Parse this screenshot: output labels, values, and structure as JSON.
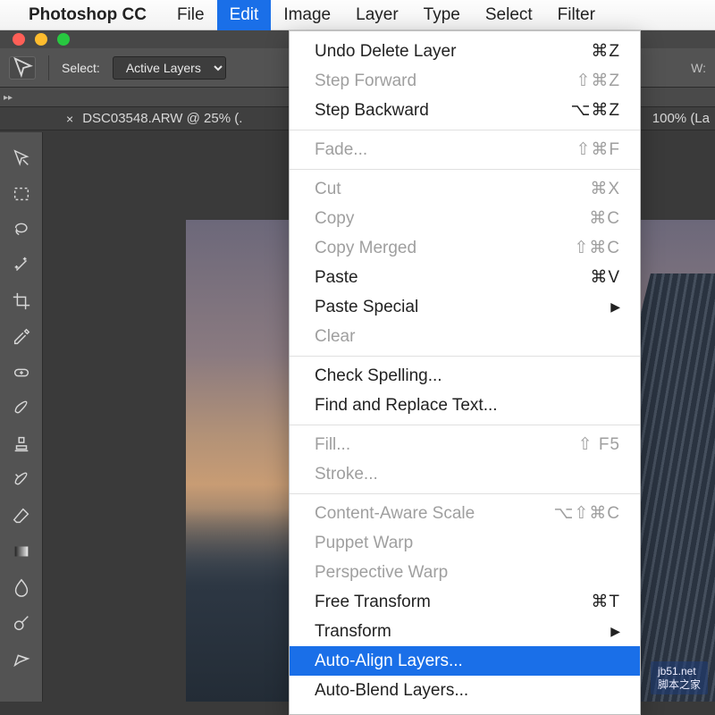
{
  "menubar": {
    "app": "Photoshop CC",
    "items": [
      "File",
      "Edit",
      "Image",
      "Layer",
      "Type",
      "Select",
      "Filter"
    ],
    "active_index": 1
  },
  "optionsbar": {
    "select_label": "Select:",
    "select_value": "Active Layers",
    "w_label": "W:"
  },
  "tab": {
    "filename": "DSC03548.ARW @ 25% (.",
    "zoom_suffix": "100% (La"
  },
  "tools": [
    "move-tool",
    "marquee-tool",
    "lasso-tool",
    "magic-wand-tool",
    "crop-tool",
    "eyedropper-tool",
    "healing-brush-tool",
    "brush-tool",
    "stamp-tool",
    "history-brush-tool",
    "eraser-tool",
    "gradient-tool",
    "blur-tool",
    "dodge-tool",
    "pen-tool"
  ],
  "edit_menu": [
    {
      "label": "Undo Delete Layer",
      "sc": "⌘Z"
    },
    {
      "label": "Step Forward",
      "sc": "⇧⌘Z",
      "disabled": true
    },
    {
      "label": "Step Backward",
      "sc": "⌥⌘Z"
    },
    {
      "sep": true
    },
    {
      "label": "Fade...",
      "sc": "⇧⌘F",
      "disabled": true
    },
    {
      "sep": true
    },
    {
      "label": "Cut",
      "sc": "⌘X",
      "disabled": true
    },
    {
      "label": "Copy",
      "sc": "⌘C",
      "disabled": true
    },
    {
      "label": "Copy Merged",
      "sc": "⇧⌘C",
      "disabled": true
    },
    {
      "label": "Paste",
      "sc": "⌘V"
    },
    {
      "label": "Paste Special",
      "submenu": true
    },
    {
      "label": "Clear",
      "disabled": true
    },
    {
      "sep": true
    },
    {
      "label": "Check Spelling..."
    },
    {
      "label": "Find and Replace Text..."
    },
    {
      "sep": true
    },
    {
      "label": "Fill...",
      "sc": "⇧ F5",
      "disabled": true
    },
    {
      "label": "Stroke...",
      "disabled": true
    },
    {
      "sep": true
    },
    {
      "label": "Content-Aware Scale",
      "sc": "⌥⇧⌘C",
      "disabled": true
    },
    {
      "label": "Puppet Warp",
      "disabled": true
    },
    {
      "label": "Perspective Warp",
      "disabled": true
    },
    {
      "label": "Free Transform",
      "sc": "⌘T"
    },
    {
      "label": "Transform",
      "submenu": true
    },
    {
      "label": "Auto-Align Layers...",
      "highlight": true
    },
    {
      "label": "Auto-Blend Layers..."
    }
  ],
  "watermark": {
    "line1": "jb51.net",
    "line2": "脚本之家"
  }
}
